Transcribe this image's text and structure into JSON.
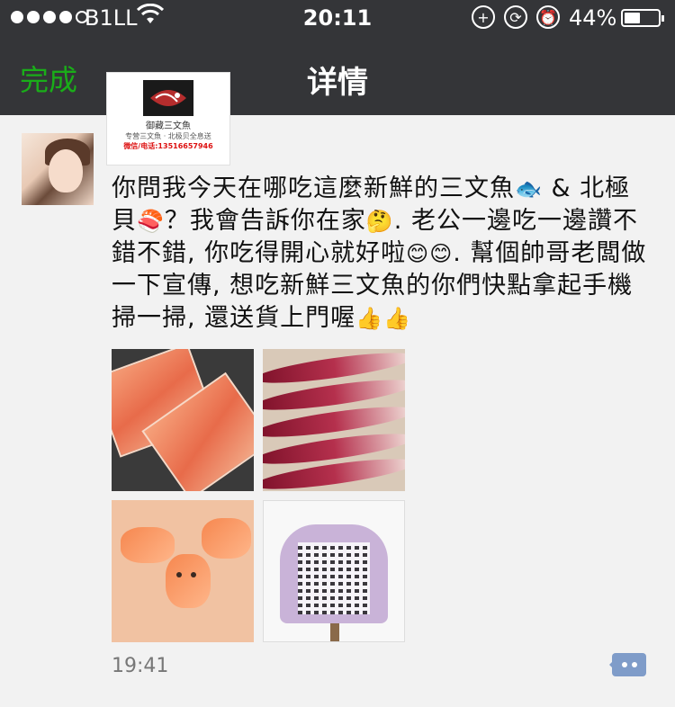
{
  "status_bar": {
    "carrier": "B1LL",
    "time": "20:11",
    "battery_percent": "44%",
    "signal_bars_filled": 4,
    "signal_bars_total": 5
  },
  "nav": {
    "done_label": "完成",
    "title": "详情"
  },
  "logo_card": {
    "name": "御藏三文魚",
    "sub": "专营三文魚 · 北极贝全息送",
    "phone": "微信/电话:13516657946"
  },
  "post": {
    "text_parts": [
      "你問我今天在哪吃這麼新鮮的三文魚",
      " & 北極貝",
      "？我會告訴你在家",
      ". 老公一邊吃一邊讚不錯不錯, 你吃得開心就好啦",
      ". 幫個帥哥老闆做一下宣傳, 想吃新鮮三文魚的你們快點拿起手機掃一掃, 還送貨上門喔"
    ],
    "emojis": [
      "fish-emoji",
      "sushi-emoji",
      "thinking-emoji",
      "smiling-emoji",
      "thumbs-up-emoji"
    ],
    "time": "19:41"
  },
  "photos": [
    {
      "name": "salmon-slices-photo"
    },
    {
      "name": "scallop-plate-photo"
    },
    {
      "name": "salmon-chopsticks-photo"
    },
    {
      "name": "qr-code-photo"
    }
  ],
  "colors": {
    "topbar": "#343538",
    "done_green": "#1aad19",
    "comment_blue": "#7f9cc9",
    "background": "#f2f2f2"
  }
}
